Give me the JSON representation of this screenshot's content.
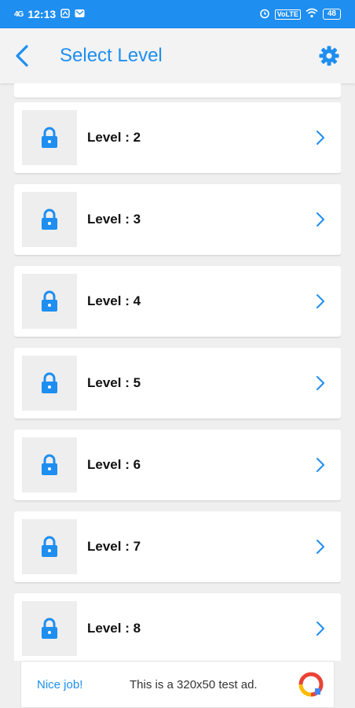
{
  "status_bar": {
    "signal": "4G",
    "time": "12:13",
    "volte": "VoLTE",
    "battery": "48"
  },
  "app_bar": {
    "title": "Select Level",
    "icons": [
      "back-arrow-icon",
      "gear-icon"
    ]
  },
  "levels": [
    {
      "label": "Level : 2",
      "locked": true
    },
    {
      "label": "Level : 3",
      "locked": true
    },
    {
      "label": "Level : 4",
      "locked": true
    },
    {
      "label": "Level : 5",
      "locked": true
    },
    {
      "label": "Level : 6",
      "locked": true
    },
    {
      "label": "Level : 7",
      "locked": true
    },
    {
      "label": "Level : 8",
      "locked": true
    }
  ],
  "ad": {
    "headline": "Nice job!",
    "text": "This is a 320x50 test ad."
  },
  "colors": {
    "accent": "#1e8ef0",
    "background": "#efefef",
    "card": "#ffffff",
    "thumb": "#eeeeee"
  }
}
